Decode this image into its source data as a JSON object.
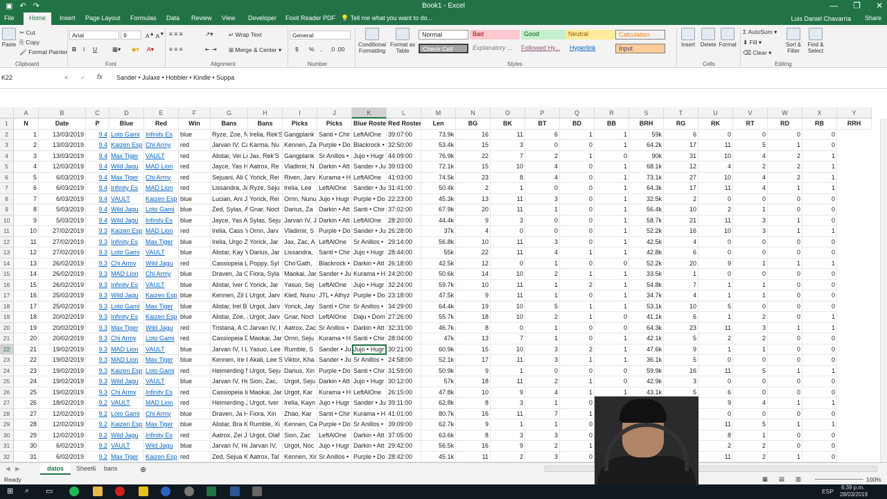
{
  "window": {
    "title": "Book1 - Excel",
    "controls": [
      "—",
      "❐",
      "✕"
    ]
  },
  "tabs": [
    "File",
    "Home",
    "Insert",
    "Page Layout",
    "Formulas",
    "Data",
    "Review",
    "View",
    "Developer",
    "Foxit Reader PDF",
    "Tell me what you want to do..."
  ],
  "user": "Luis Daniel Chavarría",
  "share": "Share",
  "ribbon": {
    "clipboard": {
      "paste": "Paste",
      "cut": "Cut",
      "copy": "Copy",
      "painter": "Format Painter",
      "label": "Clipboard"
    },
    "font": {
      "name": "Arial",
      "size": "9",
      "label": "Font",
      "bold": "B",
      "italic": "I",
      "underline": "U"
    },
    "alignment": {
      "wrap": "Wrap Text",
      "merge": "Merge & Center",
      "label": "Alignment"
    },
    "number": {
      "format": "General",
      "currency": "$",
      "percent": "%",
      "comma": ",",
      "label": "Number"
    },
    "styles": {
      "cond": "Conditional Formatting",
      "table": "Format as Table",
      "cells": [
        "Normal",
        "Bad",
        "Good",
        "Neutral",
        "Calculation",
        "Check Cell",
        "Explanatory ...",
        "Followed Hy...",
        "Hyperlink",
        "Input"
      ],
      "label": "Styles"
    },
    "cells": {
      "insert": "Insert",
      "delete": "Delete",
      "format": "Format",
      "label": "Cells"
    },
    "editing": {
      "autosum": "AutoSum",
      "fill": "Fill",
      "clear": "Clear",
      "sort": "Sort & Filter",
      "find": "Find & Select",
      "label": "Editing"
    }
  },
  "formula_bar": {
    "cell": "K22",
    "fx": "fx",
    "value": "Sander • Julaxe • Hobbler • Kindle • Suppa"
  },
  "columns": [
    "A",
    "B",
    "C",
    "D",
    "E",
    "F",
    "G",
    "H",
    "I",
    "J",
    "K",
    "L",
    "M",
    "N",
    "O",
    "P",
    "Q",
    "R",
    "S",
    "T",
    "U",
    "V",
    "W",
    "X",
    "Y"
  ],
  "header_row": [
    "N",
    "Date",
    "P",
    "Blue",
    "Red",
    "Win",
    "Bans",
    "Bans",
    "Picks",
    "Picks",
    "Blue Roster",
    "Red Roster",
    "Len",
    "BG",
    "BK",
    "BT",
    "BD",
    "BB",
    "BRH",
    "RG",
    "RK",
    "RT",
    "RD",
    "RB",
    "RRH"
  ],
  "rows": [
    [
      "1",
      "13/03/2019",
      "9.4",
      "Loto Gami",
      "Infinity Es",
      "blue",
      "Ryze, Zoe, Neeko, Yas",
      "Irelia, Rek'S",
      "Gangplank",
      "Santi • Chir",
      "LeftAlOne",
      "39:07:00",
      "73.9k",
      "16",
      "11",
      "6",
      "1",
      "1",
      "59k",
      "6",
      "0",
      "0",
      "0",
      "0"
    ],
    [
      "2",
      "13/03/2019",
      "9.4",
      "Kaizen Esp",
      "Chi Army",
      "red",
      "Jarvan IV, Cassiopeia",
      "Karma, Nu",
      "Kennen, Za",
      "Purple • Do",
      "Blackrock •",
      "32:50:00",
      "53.4k",
      "15",
      "3",
      "0",
      "0",
      "1",
      "64.2k",
      "17",
      "11",
      "5",
      "1",
      "0"
    ],
    [
      "3",
      "13/03/2019",
      "9.4",
      "Max Tiger",
      "VAULT",
      "red",
      "Alistar, Vei Lucian, Lis",
      "Jax, Rek'S",
      "Gangplank",
      "Sr Anillos •",
      "Jujo • Hugr",
      "44:09:00",
      "76.9k",
      "22",
      "7",
      "2",
      "1",
      "0",
      "90k",
      "31",
      "10",
      "4",
      "2",
      "1"
    ],
    [
      "4",
      "12/03/2019",
      "9.4",
      "Wild Jagu",
      "MAD Lion",
      "red",
      "Jayce, Yas Heimerding",
      "Aatrox, Re",
      "Vladimir, N",
      "Darkin • Att",
      "Sander • Ju",
      "39:03:00",
      "72.1k",
      "15",
      "10",
      "4",
      "0",
      "1",
      "68.1k",
      "12",
      "4",
      "2",
      "2",
      "1"
    ],
    [
      "5",
      "6/03/2019",
      "9.4",
      "Max Tiger",
      "Chi Army",
      "red",
      "Sejuani, Ali Cassiopeia",
      "Yorick, Rei",
      "Riven, Jarv",
      "Kurama • H",
      "LeftAlOne",
      "41:03:00",
      "74.5k",
      "23",
      "8",
      "4",
      "0",
      "1",
      "73.1k",
      "27",
      "10",
      "4",
      "2",
      "1"
    ],
    [
      "6",
      "6/03/2019",
      "9.4",
      "Infinity Es",
      "MAD Lion",
      "red",
      "Lissandra, Jarvan IV,",
      "Ryze, Seju",
      "Irelia, Lee",
      "LeftAlOne",
      "Sander • Ju",
      "31:41:00",
      "50.4k",
      "2",
      "1",
      "0",
      "0",
      "1",
      "64.3k",
      "17",
      "11",
      "4",
      "1",
      "1"
    ],
    [
      "7",
      "6/03/2019",
      "9.4",
      "VAULT",
      "Kaizen Esp",
      "blue",
      "Lucian, Ani Jarvan IV,",
      "Yorick, Rei",
      "Ornn, Nunu",
      "Jujo • Hugr",
      "Purple • Do",
      "22:23:00",
      "45.3k",
      "13",
      "11",
      "3",
      "0",
      "1",
      "32.5k",
      "2",
      "0",
      "0",
      "0",
      "0"
    ],
    [
      "8",
      "5/03/2019",
      "9.4",
      "Wild Jagu",
      "Loto Gami",
      "blue",
      "Zed, Sylas, Alistar, Gal",
      "Gnar, Noct",
      "Darius, Za",
      "Darkin • Att",
      "Santi • Chir",
      "37:02:00",
      "67.9k",
      "20",
      "11",
      "1",
      "0",
      "1",
      "56.4k",
      "10",
      "2",
      "1",
      "0",
      "0"
    ],
    [
      "9",
      "5/03/2019",
      "9.4",
      "Wild Jagu",
      "Infinity Es",
      "blue",
      "Jayce, Yas Alistar, Lis",
      "Sylas, Seju",
      "Jarvan IV, J",
      "Darkin • Att",
      "LeftAlOne",
      "28:20:00",
      "44.4k",
      "9",
      "3",
      "0",
      "0",
      "1",
      "58.7k",
      "21",
      "11",
      "3",
      "1",
      "0"
    ],
    [
      "10",
      "27/02/2019",
      "9.3",
      "Kaizen Esp",
      "MAD Lion",
      "red",
      "Irelia, Cass Yorick, Aur",
      "Ornn, Jarv",
      "Vladimir, S",
      "Purple • Do",
      "Sander • Ju",
      "26:28:00",
      "37k",
      "4",
      "0",
      "0",
      "0",
      "1",
      "52.2k",
      "16",
      "10",
      "3",
      "1",
      "1"
    ],
    [
      "11",
      "27/02/2019",
      "9.3",
      "Infinity Es",
      "Max Tiger",
      "blue",
      "Irelia, Urgo Zoe, Sylas,",
      "Yorick, Jar",
      "Jax, Zac, A",
      "LeftAlOne",
      "Sr Anillos •",
      "29:14:00",
      "56.8k",
      "10",
      "11",
      "3",
      "0",
      "1",
      "42.5k",
      "4",
      "0",
      "0",
      "0",
      "0"
    ],
    [
      "12",
      "27/02/2019",
      "9.3",
      "Loto Gami",
      "VAULT",
      "blue",
      "Alistar, Kay Yorick, Urg",
      "Darius, Jar",
      "Lissandra,",
      "Santi • Chir",
      "Jujo • Hugr",
      "28:44:00",
      "55k",
      "22",
      "11",
      "4",
      "1",
      "1",
      "42.8k",
      "6",
      "0",
      "0",
      "0",
      "0"
    ],
    [
      "13",
      "26/02/2019",
      "9.3",
      "Chi Army",
      "Wild Jagu",
      "red",
      "Cassiopeia Lucian, Kei",
      "Poppy, Syl",
      "Cho'Gath,",
      "Blackrock •",
      "Darkin • Att",
      "26:18:00",
      "42.5k",
      "12",
      "0",
      "1",
      "0",
      "0",
      "52.2k",
      "20",
      "9",
      "1",
      "1",
      "1"
    ],
    [
      "14",
      "26/02/2019",
      "9.3",
      "MAD Lion",
      "Chi Army",
      "blue",
      "Draven, Ja Cassiopeia",
      "Fiora, Syla",
      "Maokai, Jar",
      "Sander • Ju",
      "Kurama • H",
      "24:20:00",
      "50.6k",
      "14",
      "10",
      "2",
      "1",
      "1",
      "33.5k",
      "1",
      "0",
      "0",
      "0",
      "0"
    ],
    [
      "15",
      "26/02/2019",
      "9.3",
      "Infinity Es",
      "VAULT",
      "blue",
      "Alistar, Iver Cassiopeia",
      "Yorick, Jar",
      "Yasuo, Sej",
      "LeftAlOne",
      "Jujo • Hugr",
      "32:24:00",
      "59.7k",
      "10",
      "11",
      "1",
      "2",
      "1",
      "54.8k",
      "7",
      "1",
      "1",
      "0",
      "0"
    ],
    [
      "16",
      "25/02/2019",
      "9.3",
      "Wild Jagu",
      "Kaizen Esp",
      "blue",
      "Kennen, Zil LeBlanc, Ya",
      "Urgot, Jarv",
      "Kled, Nunu",
      "JTL • Athyz",
      "Purple • Do",
      "23:18:00",
      "47.5k",
      "9",
      "11",
      "1",
      "0",
      "1",
      "34.7k",
      "4",
      "1",
      "1",
      "0",
      "0"
    ],
    [
      "17",
      "25/02/2019",
      "9.3",
      "Loto Gami",
      "Max Tiger",
      "blue",
      "Alistar, Irel Braum, Fio",
      "Urgot, Jarv",
      "Yorick, Jay",
      "Santi • Chir",
      "Sr Anillos •",
      "34:29:00",
      "64.4k",
      "19",
      "10",
      "5",
      "1",
      "1",
      "53.1k",
      "10",
      "5",
      "0",
      "0",
      "0"
    ],
    [
      "18",
      "20/02/2019",
      "9.3",
      "Infinity Es",
      "Kaizen Esp",
      "blue",
      "Alistar, Zoe, Jayce, Urg",
      "Urgot, Jarv",
      "Gnar, Noct",
      "LeftAlOne",
      "Daju • Dom",
      "27:26:00",
      "55.7k",
      "18",
      "10",
      "2",
      "1",
      "0",
      "41.1k",
      "6",
      "1",
      "2",
      "0",
      "1"
    ],
    [
      "19",
      "20/02/2019",
      "9.3",
      "Max Tiger",
      "Wild Jagu",
      "red",
      "Tristana, A Cassiopeia",
      "Jarvan IV, I",
      "Aatrox, Zac",
      "Sr Anillos •",
      "Darkin • Att",
      "32:31:00",
      "46.7k",
      "8",
      "0",
      "1",
      "0",
      "0",
      "64.3k",
      "23",
      "11",
      "3",
      "1",
      "1"
    ],
    [
      "20",
      "20/02/2019",
      "9.3",
      "Chi Army",
      "Loto Gami",
      "red",
      "Cassiopeia Draven, Tri",
      "Maokai, Jar",
      "Ornn, Seju",
      "Kurama • H",
      "Santi • Chir",
      "28:04:00",
      "47k",
      "13",
      "7",
      "1",
      "0",
      "1",
      "42.1k",
      "5",
      "2",
      "2",
      "0",
      "0"
    ],
    [
      "21",
      "19/02/2019",
      "9.3",
      "MAD Lion",
      "VAULT",
      "blue",
      "Jarvan IV, I LeBlanc, C",
      "Yasuo, Lee",
      "Rumble, S",
      "Sander • Ju",
      "Jujo • Hugr",
      "30:21:00",
      "60.9k",
      "15",
      "10",
      "3",
      "2",
      "1",
      "47.6k",
      "9",
      "1",
      "1",
      "0",
      "0"
    ],
    [
      "22",
      "19/02/2019",
      "9.3",
      "MAD Lion",
      "Max Tiger",
      "blue",
      "Kennen, Ire Irelia, Jarva",
      "Akali, Lee S",
      "Viktor, Kha",
      "Sander • Ju",
      "Sr Anillos •",
      "24:58:00",
      "52.1k",
      "17",
      "11",
      "3",
      "1",
      "1",
      "36.1k",
      "5",
      "0",
      "0",
      "0",
      "0"
    ],
    [
      "23",
      "19/02/2019",
      "9.3",
      "Kaizen Esp",
      "Loto Gami",
      "red",
      "Heimerding Nunu, Jinx,",
      "Urgot, Seju",
      "Darius, Xin",
      "Purple • Do",
      "Santi • Chir",
      "31:59:00",
      "50.9k",
      "9",
      "1",
      "0",
      "0",
      "0",
      "59.9k",
      "16",
      "11",
      "5",
      "1",
      "1"
    ],
    [
      "24",
      "19/02/2019",
      "9.3",
      "Wild Jagu",
      "VAULT",
      "blue",
      "Jarvan IV, Heimerding",
      "Sion, Zac,",
      "Urgot, Seju",
      "Darkin • Att",
      "Jujo • Hugr",
      "30:12:00",
      "57k",
      "18",
      "11",
      "2",
      "1",
      "0",
      "42.9k",
      "3",
      "0",
      "0",
      "0",
      "0"
    ],
    [
      "25",
      "19/02/2019",
      "9.3",
      "Chi Army",
      "Infinity Es",
      "red",
      "Cassiopeia Irelia, Urgo",
      "Maokai, Jar",
      "Urgot, Kar",
      "Kurama • H",
      "LeftAlOne",
      "26:15:00",
      "47.8k",
      "10",
      "9",
      "4",
      "1",
      "1",
      "43.1k",
      "5",
      "6",
      "0",
      "0",
      "0"
    ],
    [
      "26",
      "18/02/2019",
      "9.2",
      "VAULT",
      "MAD Lion",
      "red",
      "Heimerding Jarvan IV,",
      "Urgot, Iver",
      "Irelia, Kayn",
      "Jujo • Hugr",
      "Sander • Ju",
      "39:11:00",
      "62.8k",
      "8",
      "3",
      "1",
      "0",
      "1",
      "72.7k",
      "8",
      "9",
      "4",
      "1",
      "1"
    ],
    [
      "27",
      "12/02/2019",
      "9.2",
      "Loto Gami",
      "Chi Army",
      "blue",
      "Draven, Ja Heimerding",
      "Fiora, Xin",
      "Zhao, Kar",
      "Santi • Chir",
      "Kurama • H",
      "41:01:00",
      "80.7k",
      "16",
      "11",
      "7",
      "1",
      "1",
      "69k",
      "11",
      "0",
      "0",
      "0",
      "0"
    ],
    [
      "28",
      "12/02/2019",
      "9.2",
      "Kaizen Esp",
      "Max Tiger",
      "blue",
      "Alistar, Bra Kassandra,",
      "Rumble, Xi",
      "Kennen, Ca",
      "Purple • Do",
      "Sr Anillos •",
      "39:09:00",
      "62.7k",
      "9",
      "1",
      "1",
      "0",
      "1",
      "71.5k",
      "24",
      "11",
      "5",
      "1",
      "1"
    ],
    [
      "29",
      "12/02/2019",
      "9.2",
      "Wild Jagu",
      "Infinity Es",
      "red",
      "Aatrox, Zei Jayce, Kar",
      "Urgot, Olaf",
      "Sion, Zac",
      "LeftAlOne",
      "Darkin • Att",
      "37:05:00",
      "63.6k",
      "8",
      "3",
      "3",
      "0",
      "1",
      "67.4k",
      "18",
      "8",
      "1",
      "0",
      "0"
    ],
    [
      "30",
      "6/02/2019",
      "9.2",
      "VAULT",
      "Wild Jagu",
      "blue",
      "Jarvan IV, Heimerding",
      "Jarvan IV,",
      "Urgot, Noc",
      "Jujo • Hugr",
      "Darkin • Att",
      "29:42:00",
      "56.5k",
      "16",
      "9",
      "2",
      "1",
      "1",
      "46.7k",
      "4",
      "2",
      "2",
      "0",
      "0"
    ],
    [
      "31",
      "6/02/2019",
      "9.2",
      "Max Tiger",
      "Kaizen Esp",
      "red",
      "Zed, Sejua Kindred, Ya",
      "Aatrox, Tal",
      "Kennen, Xin",
      "Sr Anillos •",
      "Purple • Do",
      "28:42:00",
      "45.1k",
      "11",
      "2",
      "3",
      "0",
      "1",
      "56.9k",
      "18",
      "11",
      "2",
      "1",
      "0"
    ]
  ],
  "sheets": [
    "datos",
    "Sheet6",
    "bans"
  ],
  "status": {
    "ready": "Ready",
    "zoom": "100%"
  },
  "taskbar": {
    "time": "6:39 p.m.",
    "date": "28/03/2019",
    "lang": "ESP"
  }
}
